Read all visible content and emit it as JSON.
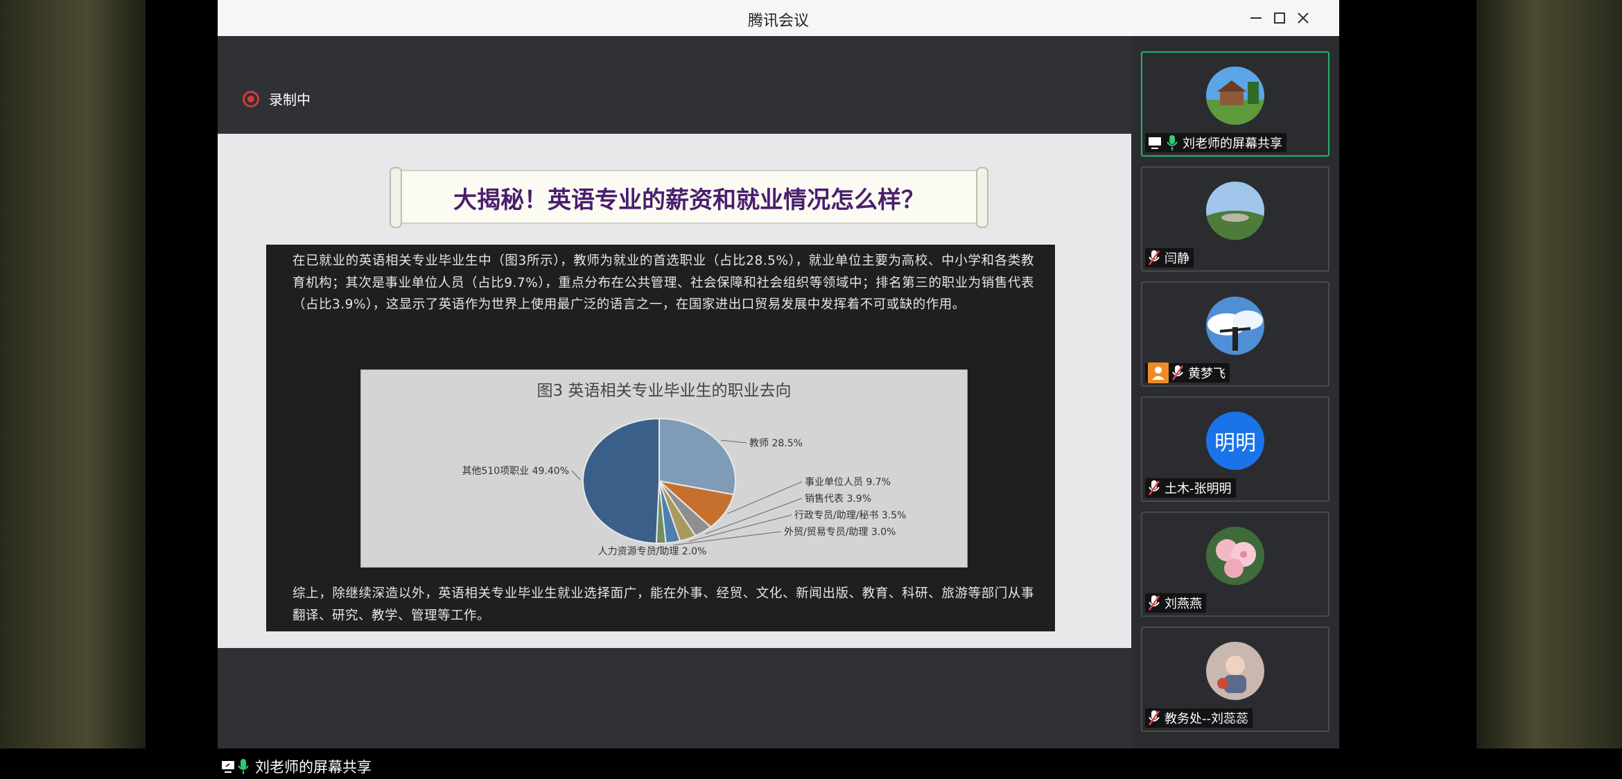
{
  "window": {
    "title": "腾讯会议",
    "controls": [
      "minimize",
      "maximize",
      "close"
    ]
  },
  "recording": {
    "label": "录制中"
  },
  "slide": {
    "banner_title": "大揭秘！英语专业的薪资和就业情况怎么样？",
    "paragraph1": "在已就业的英语相关专业毕业生中（图3所示），教师为就业的首选职业（占比28.5%），就业单位主要为高校、中小学和各类教育机构；其次是事业单位人员（占比9.7%），重点分布在公共管理、社会保障和社会组织等领域中；排名第三的职业为销售代表（占比3.9%），这显示了英语作为世界上使用最广泛的语言之一，在国家进出口贸易发展中发挥着不可或缺的作用。",
    "paragraph2": "综上，除继续深造以外，英语相关专业毕业生就业选择面广，能在外事、经贸、文化、新闻出版、教育、科研、旅游等部门从事翻译、研究、教学、管理等工作。"
  },
  "chart_data": {
    "type": "pie",
    "title": "图3 英语相关专业毕业生的职业去向",
    "slices": [
      {
        "label": "教师",
        "value": 28.5,
        "display": "28.5%",
        "color": "#7f9bb8"
      },
      {
        "label": "事业单位人员",
        "value": 9.7,
        "display": "9.7%",
        "color": "#c6702e"
      },
      {
        "label": "销售代表",
        "value": 3.9,
        "display": "3.9%",
        "color": "#8f8f8f"
      },
      {
        "label": "行政专员/助理/秘书",
        "value": 3.5,
        "display": "3.5%",
        "color": "#a89a5c"
      },
      {
        "label": "外贸/贸易专员/助理",
        "value": 3.0,
        "display": "3.0%",
        "color": "#4d7fb0"
      },
      {
        "label": "人力资源专员/助理",
        "value": 2.0,
        "display": "2.0%",
        "color": "#6e8e64"
      },
      {
        "label": "其他510项职业",
        "value": 49.4,
        "display": "49.40%",
        "color": "#3a5f88"
      }
    ]
  },
  "participants": [
    {
      "name": "刘老师的屏幕共享",
      "avatar": "house-landscape",
      "mic": "on",
      "sharing": true,
      "active": true
    },
    {
      "name": "闫静",
      "avatar": "hill-landscape",
      "mic": "muted"
    },
    {
      "name": "黄梦飞",
      "avatar": "sky-person",
      "mic": "muted",
      "badge": "user-icon"
    },
    {
      "name": "土木-张明明",
      "avatar_text": "明明",
      "mic": "muted"
    },
    {
      "name": "刘燕燕",
      "avatar": "pink-flowers",
      "mic": "muted"
    },
    {
      "name": "教务处--刘蕊蕊",
      "avatar": "child-photo",
      "mic": "muted"
    }
  ],
  "share_indicator": {
    "name": "刘老师的屏幕共享"
  },
  "colors": {
    "mic_on": "#2ecc71",
    "mic_muted": "#e04848",
    "active_border": "#1fb36a",
    "rec": "#d23b3b"
  }
}
